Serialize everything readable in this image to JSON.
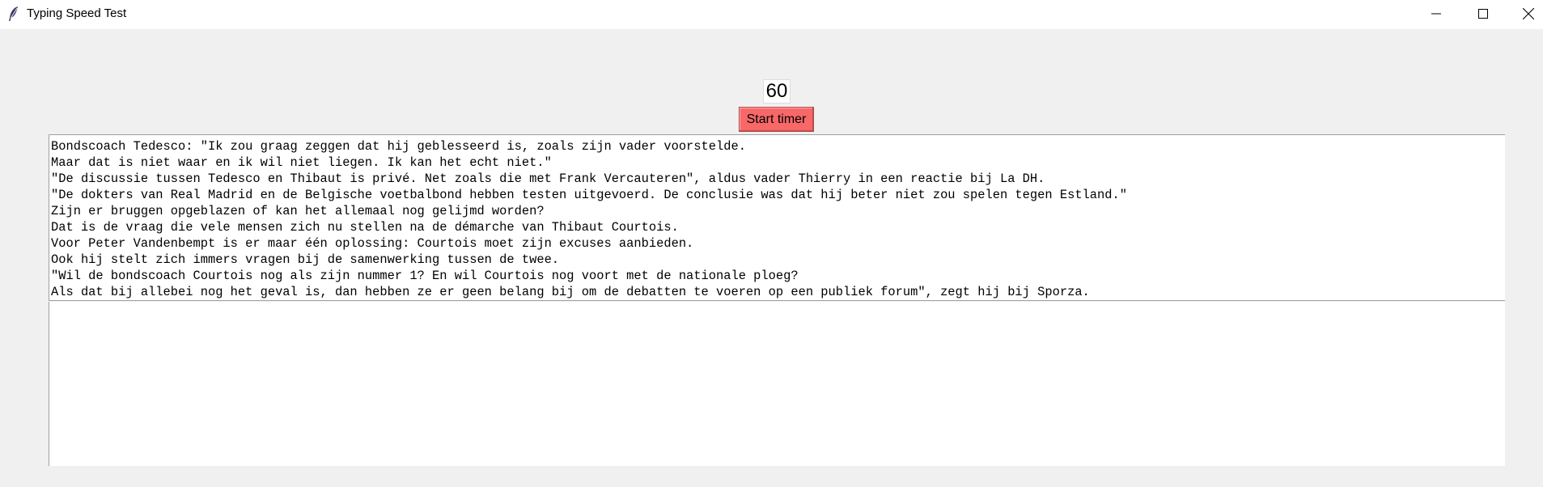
{
  "window": {
    "title": "Typing Speed Test",
    "icon": "feather-icon",
    "controls": [
      "minimize-icon",
      "maximize-icon",
      "close-icon"
    ]
  },
  "timer": {
    "value": "60"
  },
  "start_button": {
    "label": "Start timer",
    "color": "#f86868"
  },
  "source_text": {
    "lines": [
      "Bondscoach Tedesco: \"Ik zou graag zeggen dat hij geblesseerd is, zoals zijn vader voorstelde.",
      "Maar dat is niet waar en ik wil niet liegen. Ik kan het echt niet.\"",
      "\"De discussie tussen Tedesco en Thibaut is privé. Net zoals die met Frank Vercauteren\", aldus vader Thierry in een reactie bij La DH.",
      "\"De dokters van Real Madrid en de Belgische voetbalbond hebben testen uitgevoerd. De conclusie was dat hij beter niet zou spelen tegen Estland.\"",
      "Zijn er bruggen opgeblazen of kan het allemaal nog gelijmd worden?",
      "Dat is de vraag die vele mensen zich nu stellen na de démarche van Thibaut Courtois.",
      "Voor Peter Vandenbempt is er maar één oplossing: Courtois moet zijn excuses aanbieden.",
      "Ook hij stelt zich immers vragen bij de samenwerking tussen de twee.",
      "\"Wil de bondscoach Courtois nog als zijn nummer 1? En wil Courtois nog voort met de nationale ploeg?",
      "Als dat bij allebei nog het geval is, dan hebben ze er geen belang bij om de debatten te voeren op een publiek forum\", zegt hij bij Sporza."
    ]
  },
  "typing_area": {
    "value": ""
  }
}
